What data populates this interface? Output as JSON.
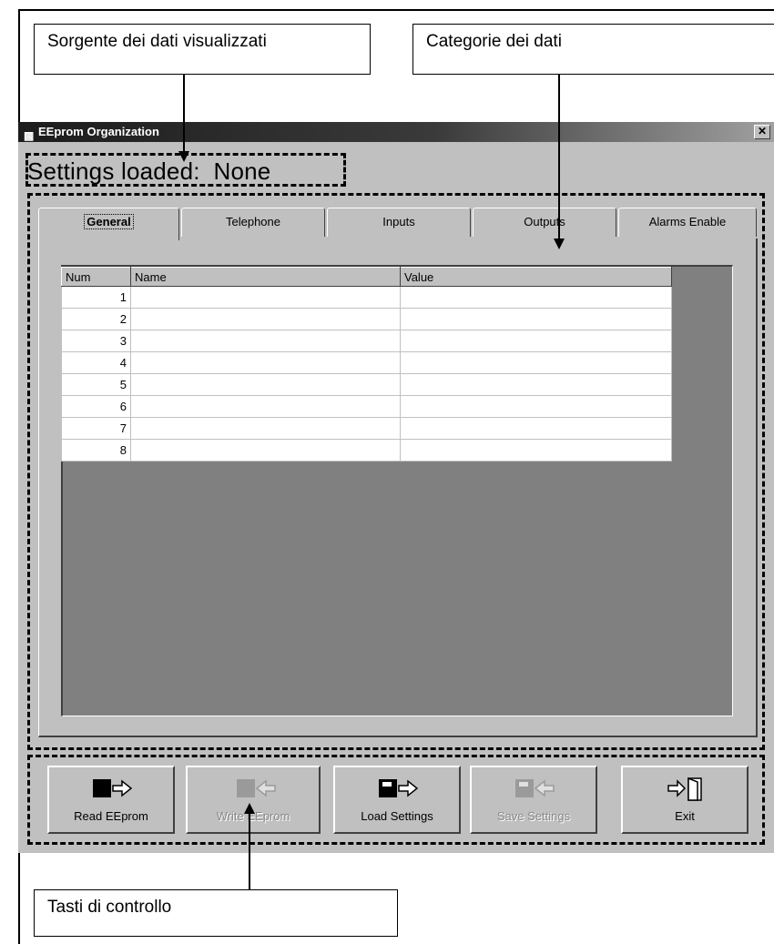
{
  "callouts": {
    "source": "Sorgente dei dati visualizzati",
    "categories": "Categorie dei dati",
    "controls": "Tasti di controllo"
  },
  "window": {
    "title": "EEprom Organization",
    "close_glyph": "✕",
    "app_icon": "window-app-icon"
  },
  "settings_loaded": "Settings loaded:  None",
  "tabs": [
    "General",
    "Telephone",
    "Inputs",
    "Outputs",
    "Alarms Enable"
  ],
  "active_tab": "General",
  "grid": {
    "headers": [
      "Num",
      "Name",
      "Value"
    ],
    "rows": [
      {
        "num": "1",
        "name": "",
        "value": ""
      },
      {
        "num": "2",
        "name": "",
        "value": ""
      },
      {
        "num": "3",
        "name": "",
        "value": ""
      },
      {
        "num": "4",
        "name": "",
        "value": ""
      },
      {
        "num": "5",
        "name": "",
        "value": ""
      },
      {
        "num": "6",
        "name": "",
        "value": ""
      },
      {
        "num": "7",
        "name": "",
        "value": ""
      },
      {
        "num": "8",
        "name": "",
        "value": ""
      }
    ]
  },
  "buttons": {
    "read": {
      "label": "Read EEprom",
      "enabled": true,
      "icon": "read-eeprom-icon"
    },
    "write": {
      "label": "Write EEprom",
      "enabled": false,
      "icon": "write-eeprom-icon"
    },
    "load": {
      "label": "Load Settings",
      "enabled": true,
      "icon": "load-settings-icon"
    },
    "save": {
      "label": "Save Settings",
      "enabled": false,
      "icon": "save-settings-icon"
    },
    "exit": {
      "label": "Exit",
      "enabled": true,
      "icon": "exit-door-icon"
    }
  },
  "colors": {
    "window_face": "#c0c0c0",
    "grid_background": "#808080",
    "disabled_text": "#8a8a8a"
  }
}
